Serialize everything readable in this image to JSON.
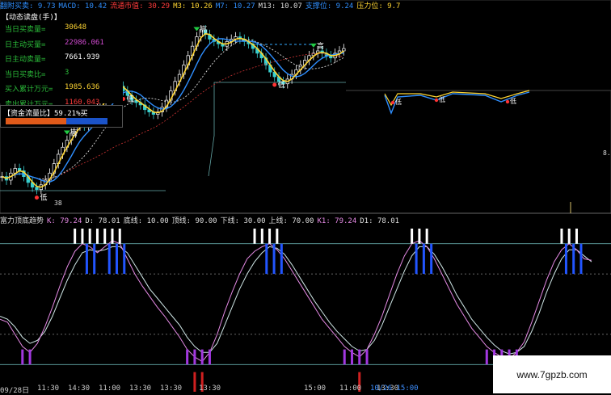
{
  "top_bar": {
    "items": [
      {
        "text": "翻附买卖: 9.73",
        "color": "#2f8fff"
      },
      {
        "text": "MACD: 10.42",
        "color": "#2f8fff"
      },
      {
        "text": "流通市值: 30.29",
        "color": "#ff3b3b"
      },
      {
        "text": "M3: 10.26",
        "color": "#ffd633"
      },
      {
        "text": "M7: 10.27",
        "color": "#2f8fff"
      },
      {
        "text": "M13: 10.07",
        "color": "#dddddd"
      },
      {
        "text": "支撑位: 9.24",
        "color": "#2f8fff"
      },
      {
        "text": "压力位: 9.7",
        "color": "#ffd633"
      }
    ]
  },
  "info_panel": {
    "title": "【动态读盘(手)】",
    "rows": [
      {
        "label": "当日买卖量=",
        "value": "30648",
        "color": "#ffd633"
      },
      {
        "label": "日主动买量=",
        "value": "22986.061",
        "color": "#d24bd2"
      },
      {
        "label": "日主动卖量=",
        "value": "7661.939",
        "color": "#ffffff"
      },
      {
        "label": "当日买卖比=",
        "value": "3",
        "color": "#2bbd3a"
      },
      {
        "label": "买入累计万元=",
        "value": "1985.636",
        "color": "#ffd633"
      },
      {
        "label": "卖出累计万元=",
        "value": "1160.043",
        "color": "#ff3b3b"
      }
    ]
  },
  "flow": {
    "label": "【资金流量比】59.21%买",
    "ratio": 0.5921
  },
  "price_labels": {
    "high": "高",
    "low": "低",
    "price_38": "38",
    "right_tick": "8."
  },
  "indicator_header": {
    "items": [
      {
        "text": "富力顶底趋势",
        "color": "#dddddd"
      },
      {
        "text": "K: 79.24",
        "color": "#e58ae5"
      },
      {
        "text": "D: 78.01",
        "color": "#dddddd"
      },
      {
        "text": "底线: 10.00",
        "color": "#dddddd"
      },
      {
        "text": "顶线: 90.00",
        "color": "#dddddd"
      },
      {
        "text": "下线: 30.00",
        "color": "#dddddd"
      },
      {
        "text": "上线: 70.00",
        "color": "#dddddd"
      },
      {
        "text": "K1: 79.24",
        "color": "#e58ae5"
      },
      {
        "text": "D1: 78.01",
        "color": "#dddddd"
      }
    ]
  },
  "time_axis": {
    "ticks": [
      "09/28日",
      "11:30",
      "14:30",
      "11:00",
      "13:30",
      "13:30",
      "13:30",
      "15:00",
      "11:00",
      "13:30",
      "10/26 15:00",
      "00"
    ],
    "highlight": "10/26 15:00"
  },
  "watermark": "www.7gpzb.com",
  "chart_data": [
    {
      "type": "line",
      "panel": "price",
      "series": [
        {
          "name": "M3",
          "color": "#ffd633"
        },
        {
          "name": "M7",
          "color": "#2f8fff"
        },
        {
          "name": "M13",
          "color": "#dddddd"
        }
      ],
      "close": [
        8.55,
        8.52,
        8.58,
        8.62,
        8.6,
        8.55,
        8.5,
        8.46,
        8.44,
        8.48,
        8.52,
        8.58,
        8.66,
        8.74,
        8.8,
        8.86,
        8.92,
        8.98,
        9.0,
        8.98,
        9.02,
        9.08,
        9.14,
        9.2,
        9.26,
        9.3,
        9.34,
        9.32,
        9.28,
        9.24,
        9.2,
        9.18,
        9.16,
        9.12,
        9.1,
        9.08,
        9.1,
        9.14,
        9.2,
        9.28,
        9.36,
        9.42,
        9.5,
        9.58,
        9.66,
        9.74,
        9.8,
        9.76,
        9.72,
        9.7,
        9.68,
        9.66,
        9.7,
        9.72,
        9.74,
        9.72,
        9.7,
        9.68,
        9.64,
        9.6,
        9.56,
        9.5,
        9.44,
        9.4,
        9.36,
        9.34,
        9.38,
        9.42,
        9.46,
        9.5,
        9.54,
        9.58,
        9.6,
        9.62,
        9.6,
        9.58,
        9.56,
        9.6,
        9.62,
        9.64
      ],
      "ylim": [
        8.3,
        9.95
      ]
    },
    {
      "type": "line",
      "panel": "indicator",
      "title": "富力顶底趋势",
      "series": [
        {
          "name": "K",
          "color": "#e58ae5"
        },
        {
          "name": "D",
          "color": "#dddddd"
        }
      ],
      "K": [
        40,
        38,
        30,
        22,
        18,
        24,
        35,
        48,
        62,
        75,
        85,
        90,
        88,
        84,
        88,
        92,
        90,
        80,
        70,
        62,
        55,
        48,
        42,
        35,
        28,
        20,
        15,
        12,
        18,
        30,
        45,
        58,
        70,
        80,
        85,
        88,
        90,
        86,
        80,
        72,
        64,
        56,
        48,
        40,
        34,
        28,
        22,
        18,
        15,
        20,
        30,
        42,
        56,
        70,
        82,
        90,
        92,
        88,
        80,
        70,
        60,
        50,
        42,
        34,
        28,
        22,
        18,
        15,
        14,
        18,
        25,
        38,
        52,
        66,
        78,
        86,
        90,
        86,
        80,
        79
      ],
      "D": [
        42,
        40,
        35,
        28,
        24,
        26,
        32,
        42,
        54,
        66,
        76,
        84,
        86,
        85,
        86,
        88,
        88,
        84,
        76,
        68,
        60,
        54,
        48,
        42,
        36,
        28,
        22,
        18,
        18,
        24,
        36,
        48,
        60,
        70,
        78,
        84,
        88,
        87,
        83,
        76,
        68,
        60,
        52,
        45,
        38,
        32,
        27,
        22,
        19,
        20,
        26,
        36,
        48,
        60,
        72,
        82,
        88,
        88,
        83,
        75,
        66,
        56,
        48,
        40,
        34,
        28,
        23,
        19,
        17,
        18,
        22,
        32,
        44,
        58,
        70,
        80,
        86,
        86,
        82,
        78
      ],
      "ylim": [
        0,
        100
      ],
      "lines": [
        {
          "name": "顶线",
          "value": 90
        },
        {
          "name": "上线",
          "value": 70
        },
        {
          "name": "下线",
          "value": 30
        },
        {
          "name": "底线",
          "value": 10
        }
      ]
    }
  ]
}
